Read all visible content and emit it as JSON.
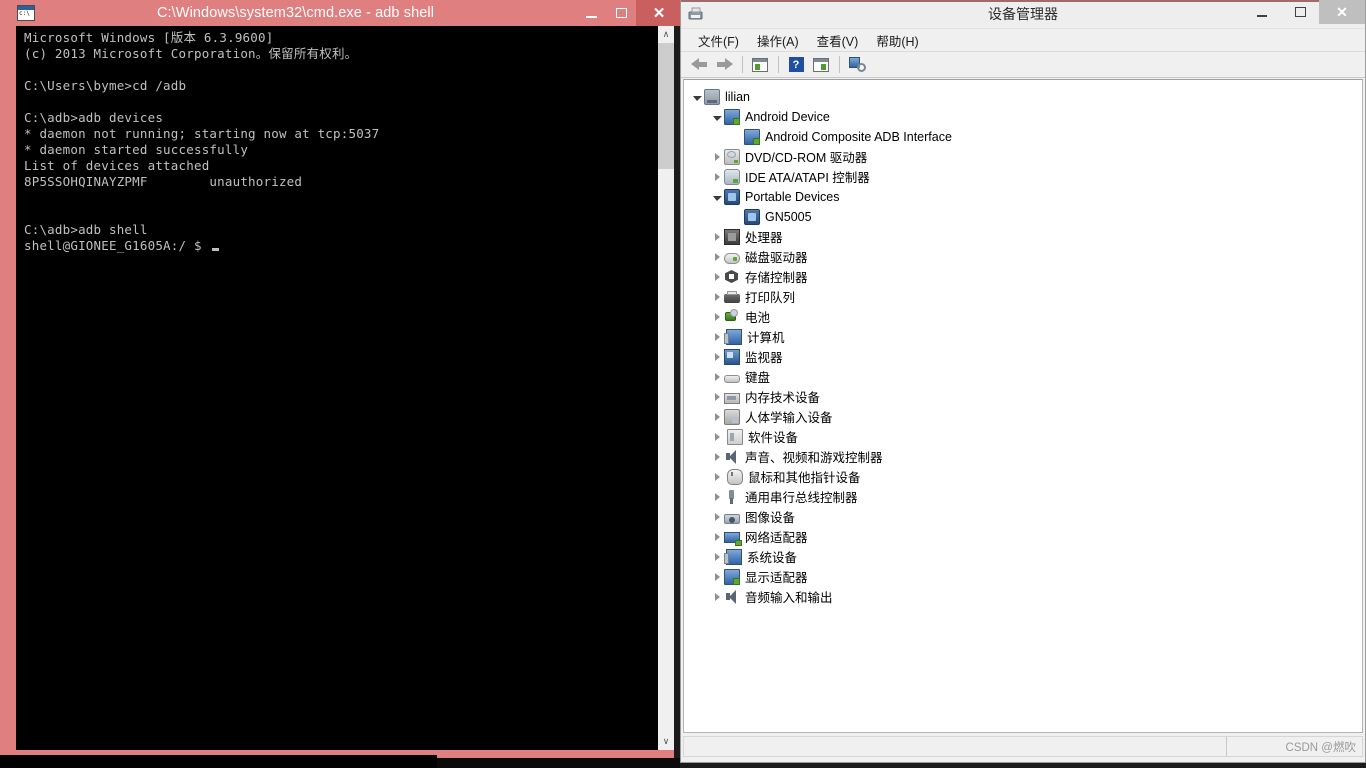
{
  "cmd_window": {
    "title": "C:\\Windows\\system32\\cmd.exe - adb  shell",
    "icon_name": "cmd-app-icon",
    "buttons": {
      "minimize": "–",
      "maximize": "□",
      "close": "✕"
    },
    "console_lines": [
      "Microsoft Windows [版本 6.3.9600]",
      "(c) 2013 Microsoft Corporation。保留所有权利。",
      "",
      "C:\\Users\\byme>cd /adb",
      "",
      "C:\\adb>adb devices",
      "* daemon not running; starting now at tcp:5037",
      "* daemon started successfully",
      "List of devices attached",
      "8P5SSOHQINAYZPMF        unauthorized",
      "",
      "",
      "C:\\adb>adb shell",
      "shell@GIONEE_G1605A:/ $ "
    ],
    "scroll_up_glyph": "∧",
    "scroll_down_glyph": "∨"
  },
  "device_manager": {
    "title": "设备管理器",
    "icon_name": "device-manager-icon",
    "buttons": {
      "minimize": "–",
      "maximize": "□",
      "close": "✕"
    },
    "menu": [
      {
        "label": "文件(F)",
        "name": "menu-file"
      },
      {
        "label": "操作(A)",
        "name": "menu-action"
      },
      {
        "label": "查看(V)",
        "name": "menu-view"
      },
      {
        "label": "帮助(H)",
        "name": "menu-help"
      }
    ],
    "toolbar": [
      {
        "name": "back-arrow-icon",
        "kind": "back"
      },
      {
        "name": "forward-arrow-icon",
        "kind": "fwd"
      },
      {
        "name": "separator-1",
        "kind": "sep"
      },
      {
        "name": "properties-panel-icon",
        "kind": "panel-left"
      },
      {
        "name": "separator-2",
        "kind": "sep"
      },
      {
        "name": "help-icon",
        "kind": "help",
        "glyph": "?"
      },
      {
        "name": "show-hidden-panel-icon",
        "kind": "panel-right"
      },
      {
        "name": "separator-3",
        "kind": "sep"
      },
      {
        "name": "scan-hardware-changes-icon",
        "kind": "scan"
      }
    ],
    "tree": [
      {
        "label": "lilian",
        "depth": 0,
        "twisty": "expanded",
        "icon": "computer-icon",
        "icon_class": "ic-computer",
        "name": "tree-node-lilian"
      },
      {
        "label": "Android Device",
        "depth": 1,
        "twisty": "expanded",
        "icon": "android-device-icon",
        "icon_class": "ic-monitor-green",
        "name": "tree-node-android-device"
      },
      {
        "label": "Android Composite ADB Interface",
        "depth": 2,
        "twisty": "none",
        "icon": "adb-interface-icon",
        "icon_class": "ic-monitor-green",
        "name": "tree-node-adb-interface"
      },
      {
        "label": "DVD/CD-ROM 驱动器",
        "depth": 1,
        "twisty": "collapsed",
        "icon": "dvd-drive-icon",
        "icon_class": "ic-disc",
        "name": "tree-node-dvd-drives"
      },
      {
        "label": "IDE ATA/ATAPI 控制器",
        "depth": 1,
        "twisty": "collapsed",
        "icon": "ide-controller-icon",
        "icon_class": "ic-ide",
        "name": "tree-node-ide-controllers"
      },
      {
        "label": "Portable Devices",
        "depth": 1,
        "twisty": "expanded",
        "icon": "portable-device-icon",
        "icon_class": "ic-portable",
        "name": "tree-node-portable-devices"
      },
      {
        "label": "GN5005",
        "depth": 2,
        "twisty": "none",
        "icon": "portable-device-icon",
        "icon_class": "ic-portable",
        "name": "tree-node-gn5005"
      },
      {
        "label": "处理器",
        "depth": 1,
        "twisty": "collapsed",
        "icon": "processor-icon",
        "icon_class": "ic-cpu",
        "name": "tree-node-processors"
      },
      {
        "label": "磁盘驱动器",
        "depth": 1,
        "twisty": "collapsed",
        "icon": "disk-drive-icon",
        "icon_class": "ic-hdd",
        "name": "tree-node-disk-drives"
      },
      {
        "label": "存储控制器",
        "depth": 1,
        "twisty": "collapsed",
        "icon": "storage-controller-icon",
        "icon_class": "ic-storage",
        "name": "tree-node-storage-controllers"
      },
      {
        "label": "打印队列",
        "depth": 1,
        "twisty": "collapsed",
        "icon": "print-queue-icon",
        "icon_class": "ic-printer",
        "name": "tree-node-print-queues"
      },
      {
        "label": "电池",
        "depth": 1,
        "twisty": "collapsed",
        "icon": "battery-icon",
        "icon_class": "ic-battery",
        "name": "tree-node-batteries"
      },
      {
        "label": "计算机",
        "depth": 1,
        "twisty": "collapsed",
        "icon": "computer-system-icon",
        "icon_class": "ic-pcsys",
        "name": "tree-node-computer"
      },
      {
        "label": "监视器",
        "depth": 1,
        "twisty": "collapsed",
        "icon": "monitor-icon",
        "icon_class": "ic-display",
        "name": "tree-node-monitors"
      },
      {
        "label": "键盘",
        "depth": 1,
        "twisty": "collapsed",
        "icon": "keyboard-icon",
        "icon_class": "ic-keyboard",
        "name": "tree-node-keyboards"
      },
      {
        "label": "内存技术设备",
        "depth": 1,
        "twisty": "collapsed",
        "icon": "memory-technology-icon",
        "icon_class": "ic-memtech",
        "name": "tree-node-memory-devices"
      },
      {
        "label": "人体学输入设备",
        "depth": 1,
        "twisty": "collapsed",
        "icon": "hid-icon",
        "icon_class": "ic-hid",
        "name": "tree-node-hid"
      },
      {
        "label": "软件设备",
        "depth": 1,
        "twisty": "collapsed",
        "icon": "software-device-icon",
        "icon_class": "ic-software",
        "name": "tree-node-software-devices"
      },
      {
        "label": "声音、视频和游戏控制器",
        "depth": 1,
        "twisty": "collapsed",
        "icon": "sound-video-game-icon",
        "icon_class": "ic-sound",
        "name": "tree-node-sound-video-game"
      },
      {
        "label": "鼠标和其他指针设备",
        "depth": 1,
        "twisty": "collapsed",
        "icon": "mouse-icon",
        "icon_class": "ic-mouse",
        "name": "tree-node-mice"
      },
      {
        "label": "通用串行总线控制器",
        "depth": 1,
        "twisty": "collapsed",
        "icon": "usb-controller-icon",
        "icon_class": "ic-usb",
        "name": "tree-node-usb-controllers"
      },
      {
        "label": "图像设备",
        "depth": 1,
        "twisty": "collapsed",
        "icon": "imaging-device-icon",
        "icon_class": "ic-imaging",
        "name": "tree-node-imaging-devices"
      },
      {
        "label": "网络适配器",
        "depth": 1,
        "twisty": "collapsed",
        "icon": "network-adapter-icon",
        "icon_class": "ic-network",
        "name": "tree-node-network-adapters"
      },
      {
        "label": "系统设备",
        "depth": 1,
        "twisty": "collapsed",
        "icon": "system-device-icon",
        "icon_class": "ic-pcsys",
        "name": "tree-node-system-devices"
      },
      {
        "label": "显示适配器",
        "depth": 1,
        "twisty": "collapsed",
        "icon": "display-adapter-icon",
        "icon_class": "ic-monitor-green",
        "name": "tree-node-display-adapters"
      },
      {
        "label": "音频输入和输出",
        "depth": 1,
        "twisty": "collapsed",
        "icon": "audio-io-icon",
        "icon_class": "ic-sound",
        "name": "tree-node-audio-io"
      }
    ],
    "statusbar": {
      "main_text": "",
      "watermark": "CSDN @燃吹"
    }
  }
}
